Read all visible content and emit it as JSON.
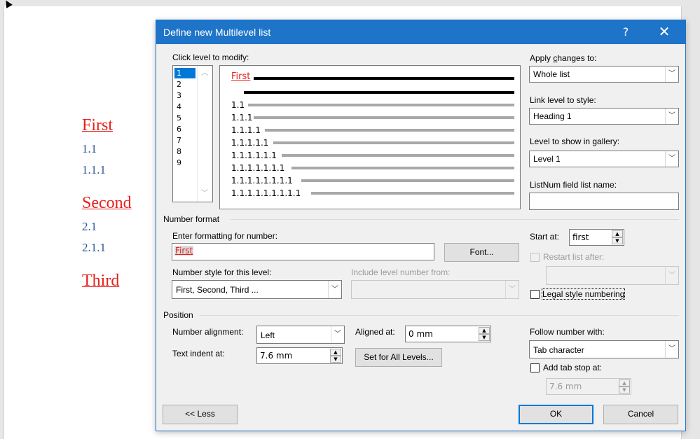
{
  "document": {
    "headings": [
      "First",
      "Second",
      "Third"
    ],
    "subitems": [
      "1.1",
      "1.1.1",
      "2.1",
      "2.1.1"
    ]
  },
  "dialog": {
    "title": "Define new Multilevel list",
    "help": "?",
    "close": "✕",
    "click_level_label": "Click level to modify:",
    "levels": [
      "1",
      "2",
      "3",
      "4",
      "5",
      "6",
      "7",
      "8",
      "9"
    ],
    "selected_level": "1",
    "preview": {
      "first": "First",
      "rows": [
        "1.1",
        "1.1.1",
        "1.1.1.1",
        "1.1.1.1.1",
        "1.1.1.1.1.1",
        "1.1.1.1.1.1.1",
        "1.1.1.1.1.1.1.1",
        "1.1.1.1.1.1.1.1.1"
      ]
    },
    "apply_changes_label": "Apply changes to:",
    "apply_changes_value": "Whole list",
    "link_level_label": "Link level to style:",
    "link_level_value": "Heading 1",
    "level_gallery_label": "Level to show in gallery:",
    "level_gallery_value": "Level 1",
    "listnum_label": "ListNum field list name:",
    "listnum_value": "",
    "number_format_section": "Number format",
    "enter_formatting_label": "Enter formatting for number:",
    "enter_formatting_value": "First",
    "font_button": "Font...",
    "number_style_label": "Number style for this level:",
    "number_style_value": "First, Second, Third ...",
    "include_level_label": "Include level number from:",
    "include_level_value": "",
    "start_at_label": "Start at:",
    "start_at_value": "first",
    "restart_list_label": "Restart list after:",
    "restart_list_value": "",
    "legal_style_label": "Legal style numbering",
    "position_section": "Position",
    "number_alignment_label": "Number alignment:",
    "number_alignment_value": "Left",
    "aligned_at_label": "Aligned at:",
    "aligned_at_value": "0 mm",
    "text_indent_label": "Text indent at:",
    "text_indent_value": "7.6 mm",
    "set_all_levels_button": "Set for All Levels...",
    "follow_number_label": "Follow number with:",
    "follow_number_value": "Tab character",
    "add_tab_stop_label": "Add tab stop at:",
    "add_tab_stop_value": "7.6 mm",
    "less_button": "<< Less",
    "ok_button": "OK",
    "cancel_button": "Cancel"
  },
  "colors": {
    "titlebar": "#1e74c8",
    "heading_red": "#e8201c",
    "subitem_blue": "#2f5496",
    "selection": "#0078d7"
  }
}
